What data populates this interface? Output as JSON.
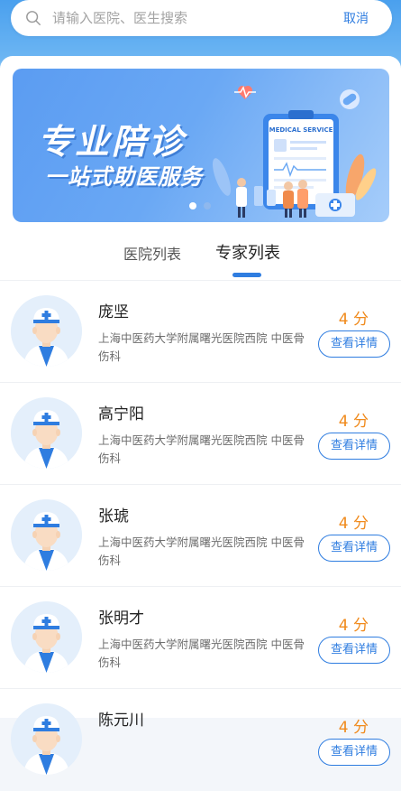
{
  "search": {
    "placeholder": "请输入医院、医生搜索",
    "cancel_label": "取消"
  },
  "banner": {
    "title": "专业陪诊",
    "subtitle": "一站式助医服务",
    "card_label": "MEDICAL SERVICE",
    "slide_count": 2,
    "active_slide": 1
  },
  "tabs": [
    {
      "label": "医院列表",
      "active": false
    },
    {
      "label": "专家列表",
      "active": true
    }
  ],
  "doctors": [
    {
      "name": "庞坚",
      "hospital": "上海中医药大学附属曙光医院西院 中医骨伤科",
      "score": "4 分",
      "button": "查看详情"
    },
    {
      "name": "高宁阳",
      "hospital": "上海中医药大学附属曙光医院西院 中医骨伤科",
      "score": "4 分",
      "button": "查看详情"
    },
    {
      "name": "张琥",
      "hospital": "上海中医药大学附属曙光医院西院 中医骨伤科",
      "score": "4 分",
      "button": "查看详情"
    },
    {
      "name": "张明才",
      "hospital": "上海中医药大学附属曙光医院西院 中医骨伤科",
      "score": "4 分",
      "button": "查看详情"
    },
    {
      "name": "陈元川",
      "hospital": "",
      "score": "4 分",
      "button": "查看详情"
    }
  ],
  "colors": {
    "accent": "#2f7de0",
    "score": "#f08a1c"
  }
}
